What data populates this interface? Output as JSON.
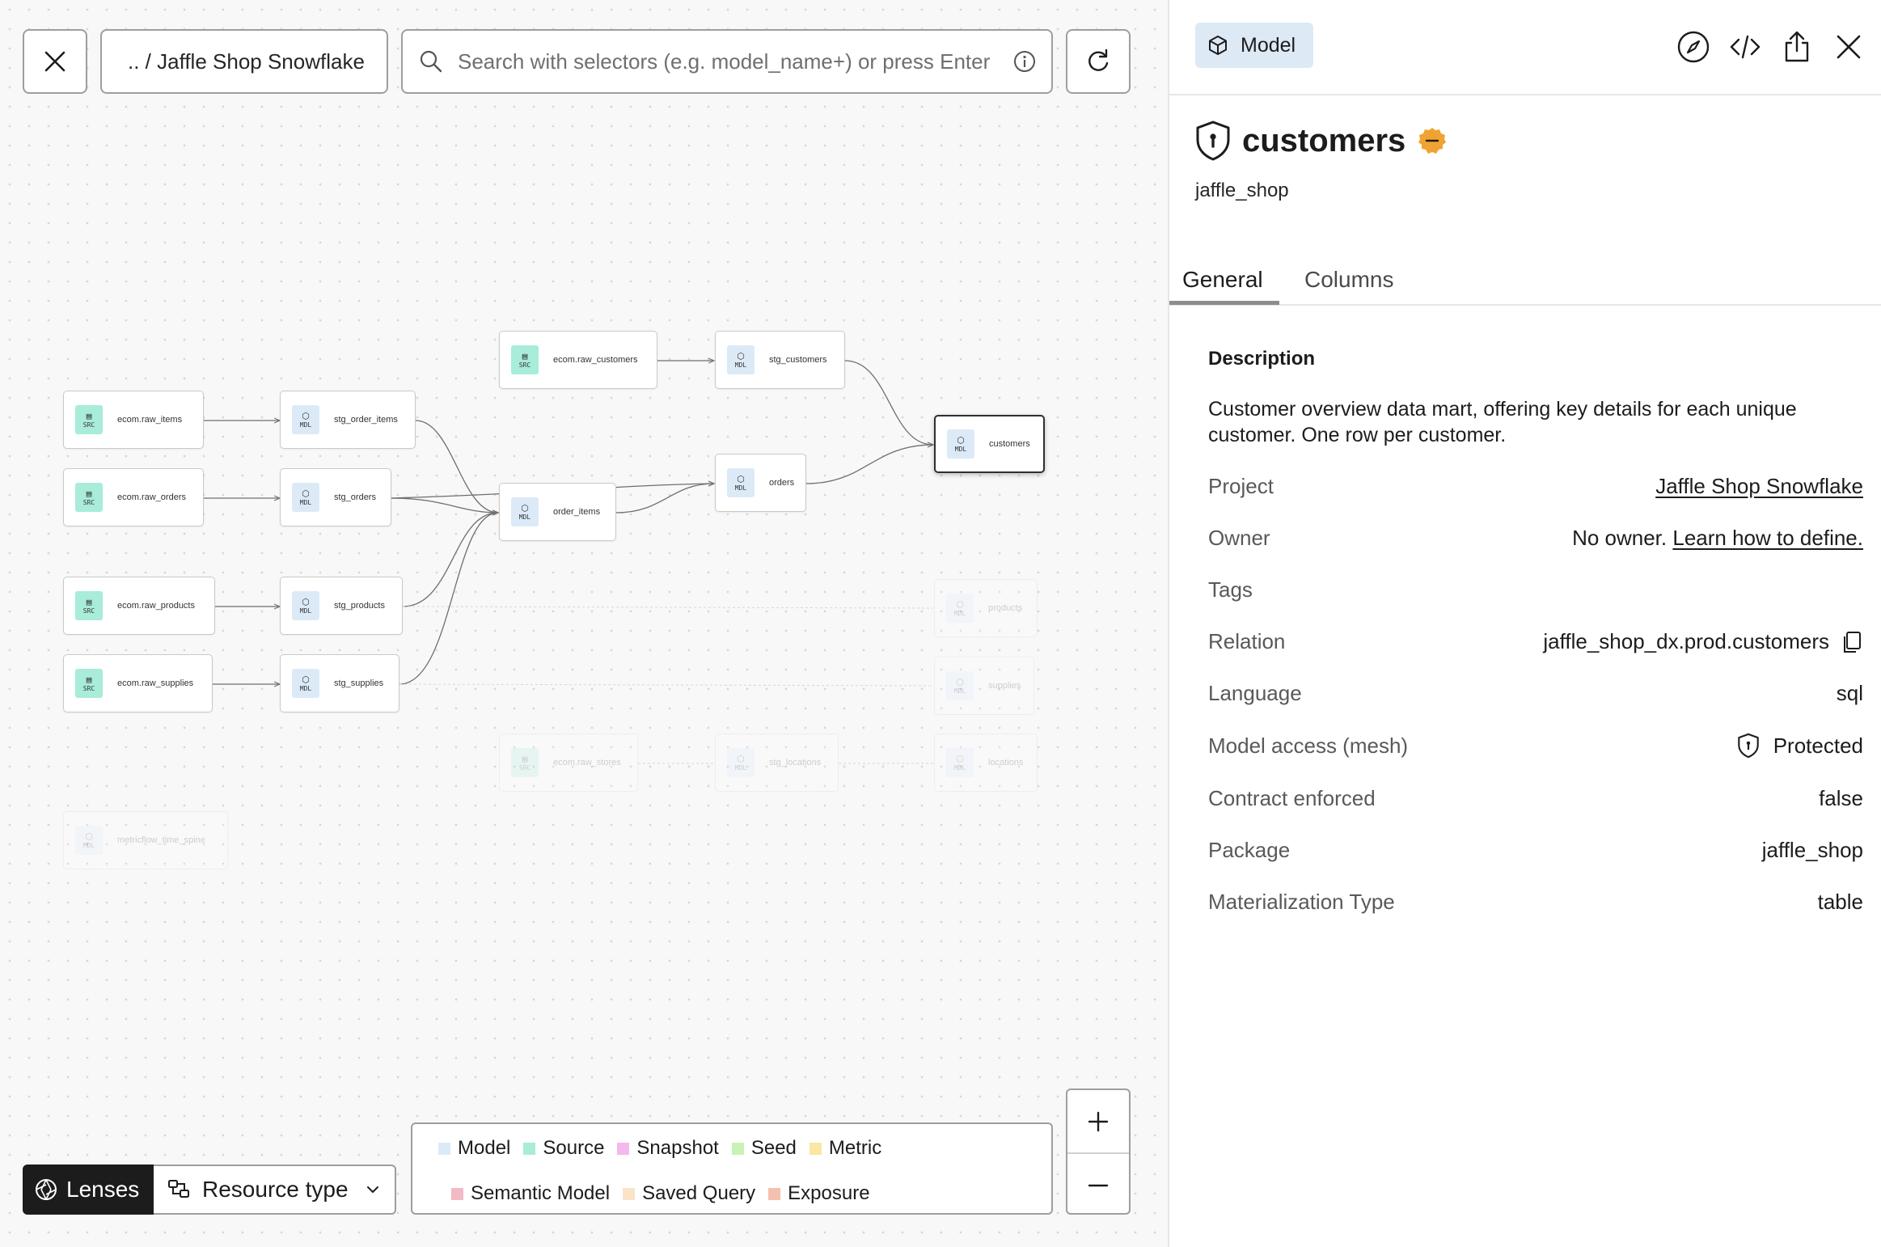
{
  "toolbar": {
    "breadcrumb": ".. / Jaffle Shop Snowflake",
    "search_placeholder": "Search with selectors (e.g. model_name+) or press Enter"
  },
  "graph": {
    "nodes": [
      {
        "id": "ecom_raw_customers",
        "label": "ecom.raw_customers",
        "badge": "SRC"
      },
      {
        "id": "stg_customers",
        "label": "stg_customers",
        "badge": "MDL"
      },
      {
        "id": "ecom_raw_items",
        "label": "ecom.raw_items",
        "badge": "SRC"
      },
      {
        "id": "stg_order_items",
        "label": "stg_order_items",
        "badge": "MDL"
      },
      {
        "id": "ecom_raw_orders",
        "label": "ecom.raw_orders",
        "badge": "SRC"
      },
      {
        "id": "stg_orders",
        "label": "stg_orders",
        "badge": "MDL"
      },
      {
        "id": "order_items",
        "label": "order_items",
        "badge": "MDL"
      },
      {
        "id": "orders",
        "label": "orders",
        "badge": "MDL"
      },
      {
        "id": "customers",
        "label": "customers",
        "badge": "MDL"
      },
      {
        "id": "ecom_raw_products",
        "label": "ecom.raw_products",
        "badge": "SRC"
      },
      {
        "id": "stg_products",
        "label": "stg_products",
        "badge": "MDL"
      },
      {
        "id": "products",
        "label": "products",
        "badge": "MDL"
      },
      {
        "id": "ecom_raw_supplies",
        "label": "ecom.raw_supplies",
        "badge": "SRC"
      },
      {
        "id": "stg_supplies",
        "label": "stg_supplies",
        "badge": "MDL"
      },
      {
        "id": "supplies",
        "label": "supplies",
        "badge": "MDL"
      },
      {
        "id": "ecom_raw_stores",
        "label": "ecom.raw_stores",
        "badge": "SRC"
      },
      {
        "id": "stg_locations",
        "label": "stg_locations",
        "badge": "MDL"
      },
      {
        "id": "locations",
        "label": "locations",
        "badge": "MDL"
      },
      {
        "id": "metricflow_time_spine",
        "label": "metricflow_time_spine",
        "badge": "MDL"
      }
    ]
  },
  "controls": {
    "lenses_label": "Lenses",
    "resource_type_label": "Resource type"
  },
  "legend": {
    "row1": [
      {
        "label": "Model",
        "color": "#dceaf8"
      },
      {
        "label": "Source",
        "color": "#a8ecd9"
      },
      {
        "label": "Snapshot",
        "color": "#f4b8ec"
      },
      {
        "label": "Seed",
        "color": "#c9f2b4"
      },
      {
        "label": "Metric",
        "color": "#fbe6a3"
      }
    ],
    "row2": [
      {
        "label": "Semantic Model",
        "color": "#f3b9c4"
      },
      {
        "label": "Saved Query",
        "color": "#fbe3c8"
      },
      {
        "label": "Exposure",
        "color": "#f6c0ae"
      }
    ]
  },
  "panel": {
    "type_label": "Model",
    "title": "customers",
    "package_subtitle": "jaffle_shop",
    "tabs": {
      "general": "General",
      "columns": "Columns"
    },
    "description_heading": "Description",
    "description": "Customer overview data mart, offering key details for each unique customer. One row per customer.",
    "properties": {
      "project_key": "Project",
      "project_value": "Jaffle Shop Snowflake",
      "owner_key": "Owner",
      "owner_value": "No owner.",
      "owner_link": "Learn how to define.",
      "tags_key": "Tags",
      "relation_key": "Relation",
      "relation_value": "jaffle_shop_dx.prod.customers",
      "language_key": "Language",
      "language_value": "sql",
      "access_key": "Model access (mesh)",
      "access_value": "Protected",
      "contract_key": "Contract enforced",
      "contract_value": "false",
      "package_key": "Package",
      "package_value": "jaffle_shop",
      "materialization_key": "Materialization Type",
      "materialization_value": "table"
    },
    "status_color": "#f0a332"
  }
}
